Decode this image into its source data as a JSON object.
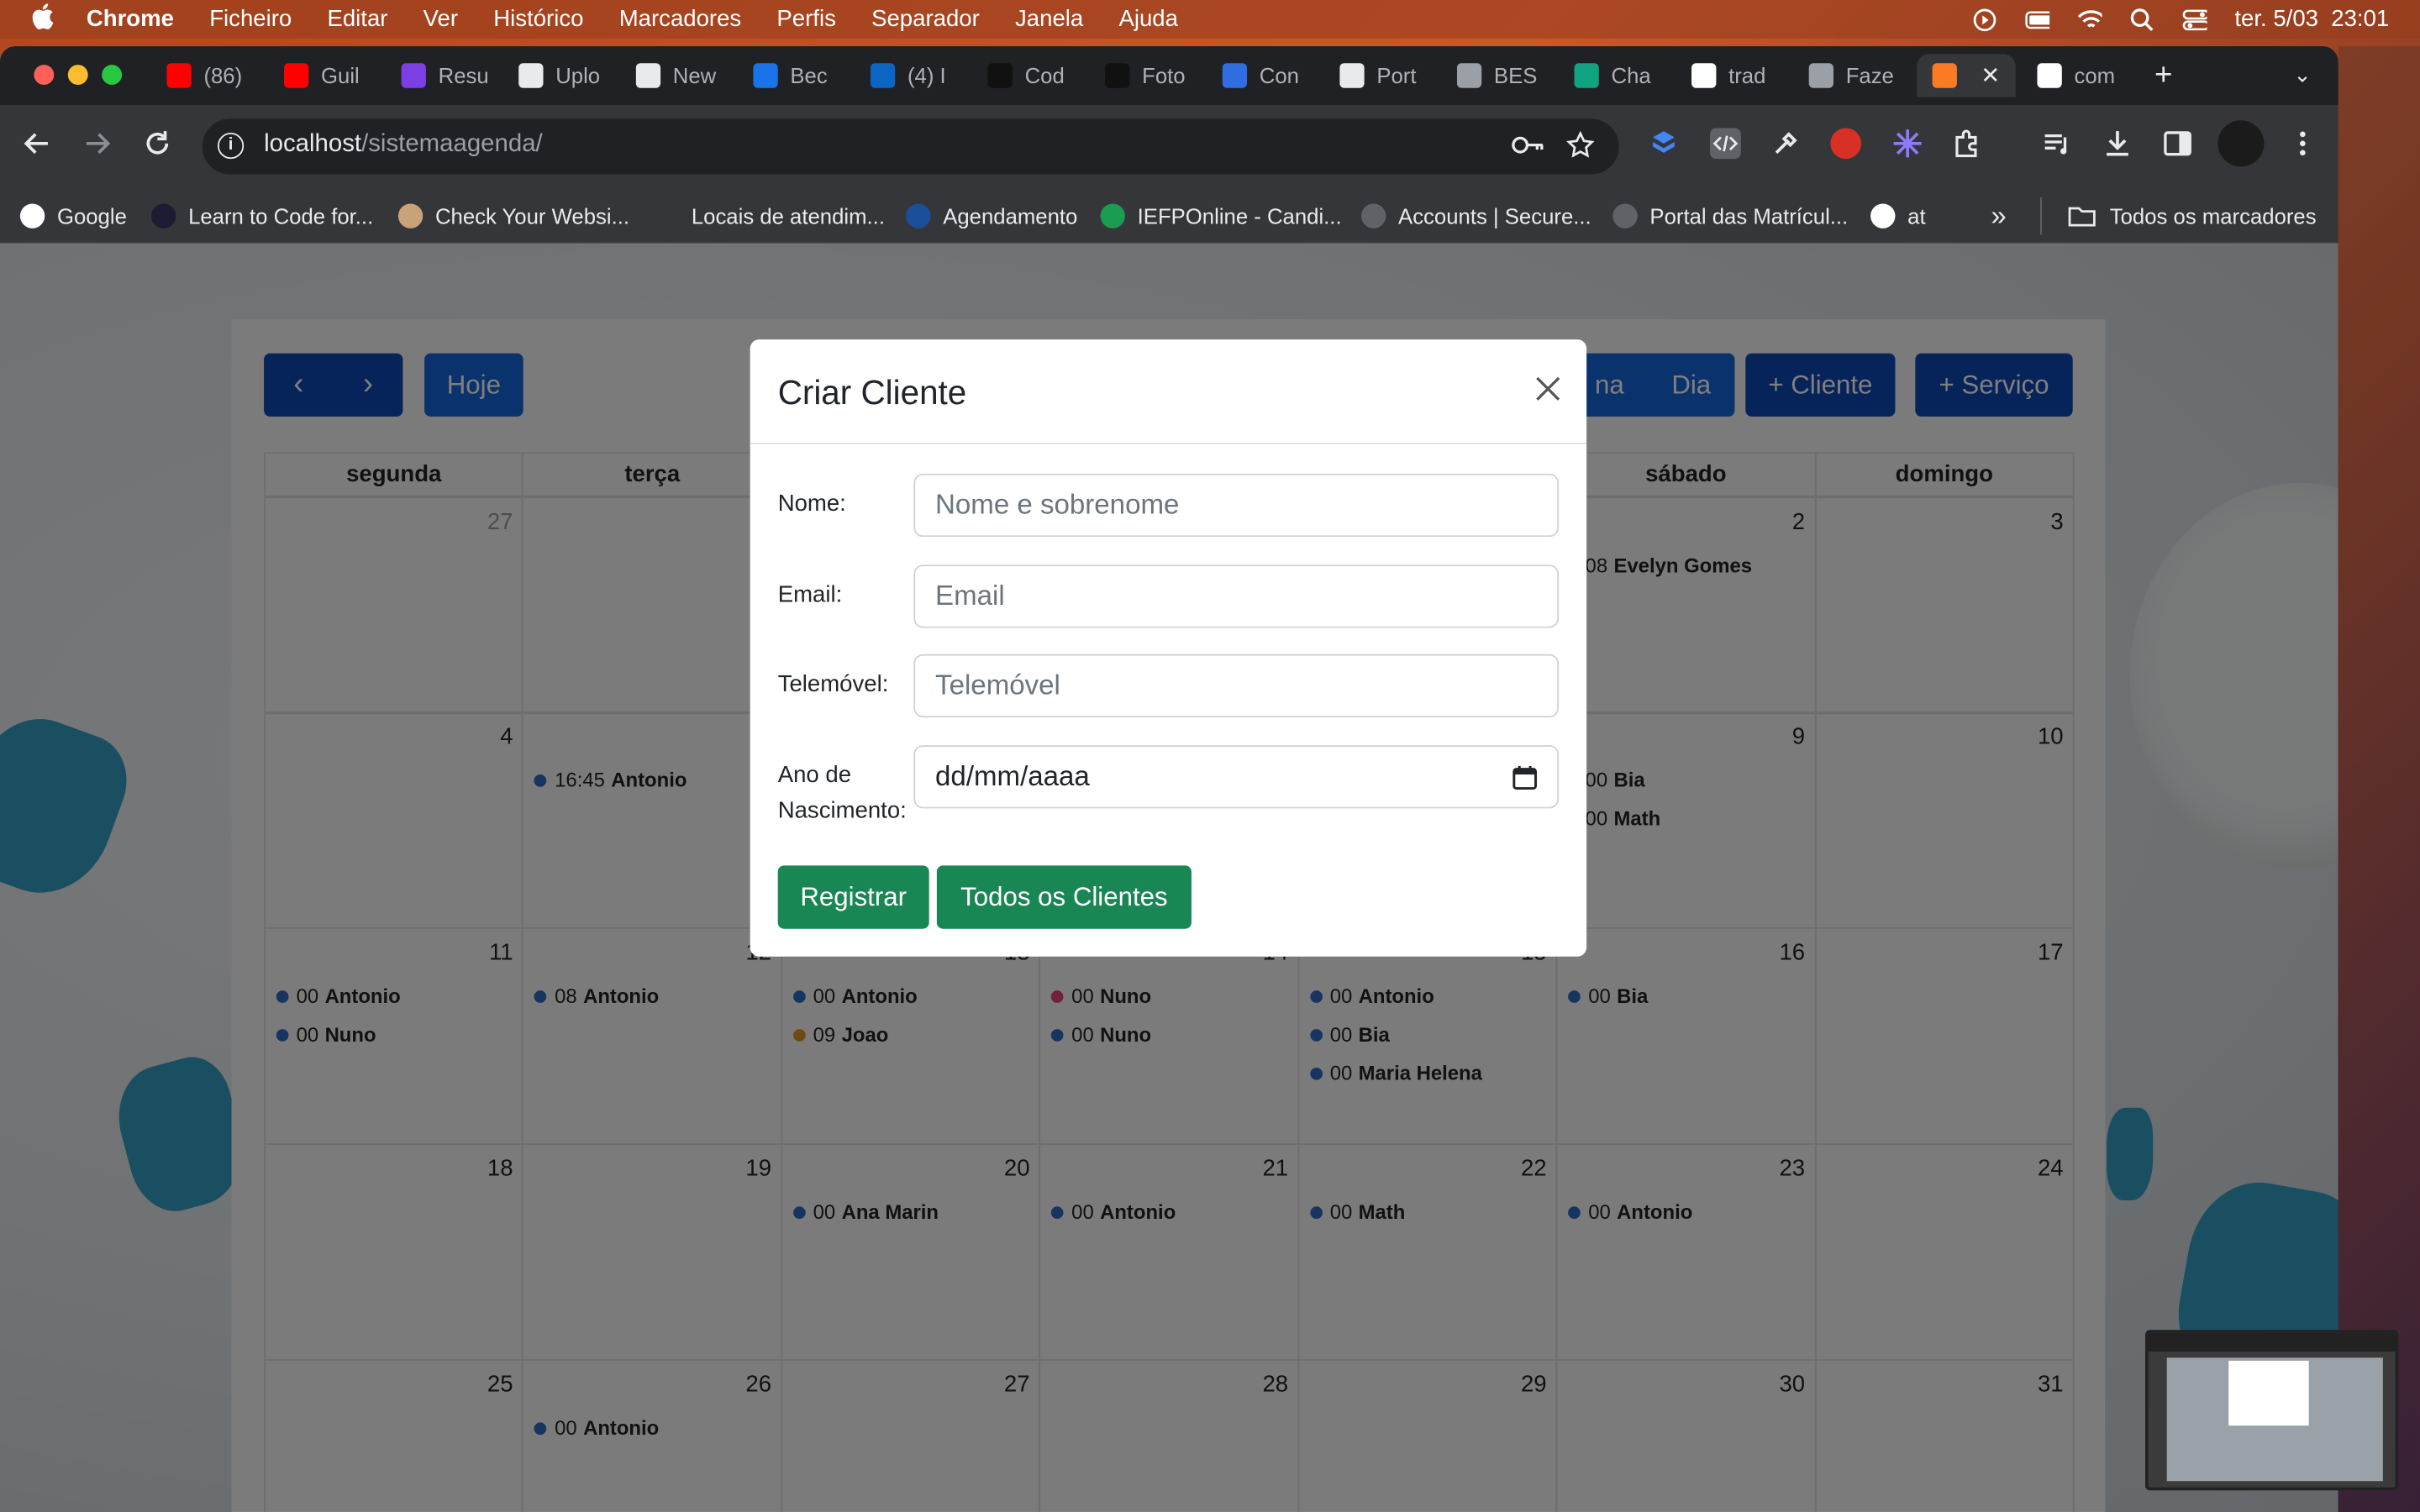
{
  "menubar": {
    "app": "Chrome",
    "items": [
      "Ficheiro",
      "Editar",
      "Ver",
      "Histórico",
      "Marcadores",
      "Perfis",
      "Separador",
      "Janela",
      "Ajuda"
    ],
    "clock": "ter. 5/03  23:01"
  },
  "tabs": [
    {
      "label": "(86)",
      "icon": "youtube-icon",
      "color": "#ff0000"
    },
    {
      "label": "Guil",
      "icon": "youtube-icon",
      "color": "#ff0000"
    },
    {
      "label": "Resu",
      "icon": "purple-app-icon",
      "color": "#7b3fe4"
    },
    {
      "label": "Uplo",
      "icon": "github-icon",
      "color": "#e8eaed"
    },
    {
      "label": "New",
      "icon": "github-icon",
      "color": "#e8eaed"
    },
    {
      "label": "Bec",
      "icon": "play-icon",
      "color": "#1a73e8"
    },
    {
      "label": "(4) I",
      "icon": "linkedin-icon",
      "color": "#0a66c2"
    },
    {
      "label": "Cod",
      "icon": "dark-square-icon",
      "color": "#111111"
    },
    {
      "label": "Foto",
      "icon": "dark-square-icon",
      "color": "#111111"
    },
    {
      "label": "Con",
      "icon": "doc-icon",
      "color": "#2f6ee0"
    },
    {
      "label": "Port",
      "icon": "behance-icon",
      "color": "#e8eaed"
    },
    {
      "label": "BES",
      "icon": "globe-icon",
      "color": "#9aa0a6"
    },
    {
      "label": "Cha",
      "icon": "chatgpt-icon",
      "color": "#10a37f"
    },
    {
      "label": "trad",
      "icon": "google-icon",
      "color": "#ffffff"
    },
    {
      "label": "Faze",
      "icon": "layers-icon",
      "color": "#9aa0a6"
    },
    {
      "label": "",
      "icon": "xampp-icon",
      "color": "#fb7a24"
    },
    {
      "label": "com",
      "icon": "google-icon",
      "color": "#ffffff"
    }
  ],
  "address": {
    "host": "localhost",
    "path": "/sistemaagenda/"
  },
  "bookmarks": [
    {
      "label": "Google",
      "icon": "google-icon"
    },
    {
      "label": "Learn to Code for...",
      "icon": "fcc-icon"
    },
    {
      "label": "Check Your Websi...",
      "icon": "avatar-icon"
    },
    {
      "label": "Locais de atendim...",
      "icon": "dot-icon"
    },
    {
      "label": "Agendamento",
      "icon": "sef-icon"
    },
    {
      "label": "IEFPOnline - Candi...",
      "icon": "iefp-icon"
    },
    {
      "label": "Accounts | Secure...",
      "icon": "globe-icon"
    },
    {
      "label": "Portal das Matrícul...",
      "icon": "portal-icon"
    },
    {
      "label": "at",
      "icon": "at-icon"
    }
  ],
  "bookmarks_all": "Todos os marcadores",
  "calendar": {
    "today_btn": "Hoje",
    "view_partial": "na",
    "view_day": "Dia",
    "add_client": "+ Cliente",
    "add_service": "+ Serviço",
    "weekdays": [
      "segunda",
      "terça",
      "",
      "",
      "",
      "sábado",
      "domingo"
    ],
    "weeks": [
      [
        {
          "d": "27",
          "muted": true,
          "ev": []
        },
        {
          "d": "",
          "ev": []
        },
        {
          "d": "",
          "ev": []
        },
        {
          "d": "",
          "ev": []
        },
        {
          "d": "",
          "ev": []
        },
        {
          "d": "2",
          "ev": [
            {
              "t": "08",
              "n": "Evelyn Gomes",
              "c": "none"
            }
          ]
        },
        {
          "d": "3",
          "ev": []
        }
      ],
      [
        {
          "d": "4",
          "ev": []
        },
        {
          "d": "",
          "ev": [
            {
              "t": "16:45",
              "n": "Antonio",
              "c": "#2f6bc0"
            }
          ]
        },
        {
          "d": "",
          "ev": []
        },
        {
          "d": "",
          "ev": []
        },
        {
          "d": "",
          "ev": []
        },
        {
          "d": "9",
          "ev": [
            {
              "t": "00",
              "n": "Bia",
              "c": "none"
            },
            {
              "t": "00",
              "n": "Math",
              "c": "none"
            }
          ]
        },
        {
          "d": "10",
          "ev": []
        }
      ],
      [
        {
          "d": "11",
          "ev": [
            {
              "t": "00",
              "n": "Antonio",
              "c": "#2f6bc0"
            },
            {
              "t": "00",
              "n": "Nuno",
              "c": "#2f6bc0"
            }
          ]
        },
        {
          "d": "12",
          "ev": [
            {
              "t": "08",
              "n": "Antonio",
              "c": "#2f6bc0"
            }
          ]
        },
        {
          "d": "13",
          "ev": [
            {
              "t": "00",
              "n": "Antonio",
              "c": "#2f6bc0"
            },
            {
              "t": "09",
              "n": "Joao",
              "c": "#e0952a"
            }
          ]
        },
        {
          "d": "14",
          "ev": [
            {
              "t": "00",
              "n": "Nuno",
              "c": "#e0457b"
            },
            {
              "t": "00",
              "n": "Nuno",
              "c": "#2f6bc0"
            }
          ]
        },
        {
          "d": "15",
          "ev": [
            {
              "t": "00",
              "n": "Antonio",
              "c": "#2f6bc0"
            },
            {
              "t": "00",
              "n": "Bia",
              "c": "#2f6bc0"
            },
            {
              "t": "00",
              "n": "Maria Helena",
              "c": "#2f6bc0"
            }
          ]
        },
        {
          "d": "16",
          "ev": [
            {
              "t": "00",
              "n": "Bia",
              "c": "#2f6bc0"
            }
          ]
        },
        {
          "d": "17",
          "ev": []
        }
      ],
      [
        {
          "d": "18",
          "ev": []
        },
        {
          "d": "19",
          "ev": []
        },
        {
          "d": "20",
          "ev": [
            {
              "t": "00",
              "n": "Ana Marin",
              "c": "#2f6bc0"
            }
          ]
        },
        {
          "d": "21",
          "ev": [
            {
              "t": "00",
              "n": "Antonio",
              "c": "#2f6bc0"
            }
          ]
        },
        {
          "d": "22",
          "ev": [
            {
              "t": "00",
              "n": "Math",
              "c": "#2f6bc0"
            }
          ]
        },
        {
          "d": "23",
          "ev": [
            {
              "t": "00",
              "n": "Antonio",
              "c": "#2f6bc0"
            }
          ]
        },
        {
          "d": "24",
          "ev": []
        }
      ],
      [
        {
          "d": "25",
          "ev": []
        },
        {
          "d": "26",
          "ev": [
            {
              "t": "00",
              "n": "Antonio",
              "c": "#2f6bc0"
            }
          ]
        },
        {
          "d": "27",
          "ev": []
        },
        {
          "d": "28",
          "ev": []
        },
        {
          "d": "29",
          "ev": []
        },
        {
          "d": "30",
          "ev": []
        },
        {
          "d": "31",
          "ev": []
        }
      ]
    ]
  },
  "modal": {
    "title": "Criar Cliente",
    "nome_label": "Nome:",
    "nome_placeholder": "Nome e sobrenome",
    "email_label": "Email:",
    "email_placeholder": "Email",
    "tel_label": "Telemóvel:",
    "tel_placeholder": "Telemóvel",
    "ano_label_1": "Ano de",
    "ano_label_2": "Nascimento:",
    "date_placeholder": "dd/mm/aaaa",
    "register_btn": "Registrar",
    "all_clients_btn": "Todos os Clientes"
  },
  "colors": {
    "primary": "#0d47b5",
    "success": "#198754",
    "event_blue": "#2f6bc0"
  }
}
